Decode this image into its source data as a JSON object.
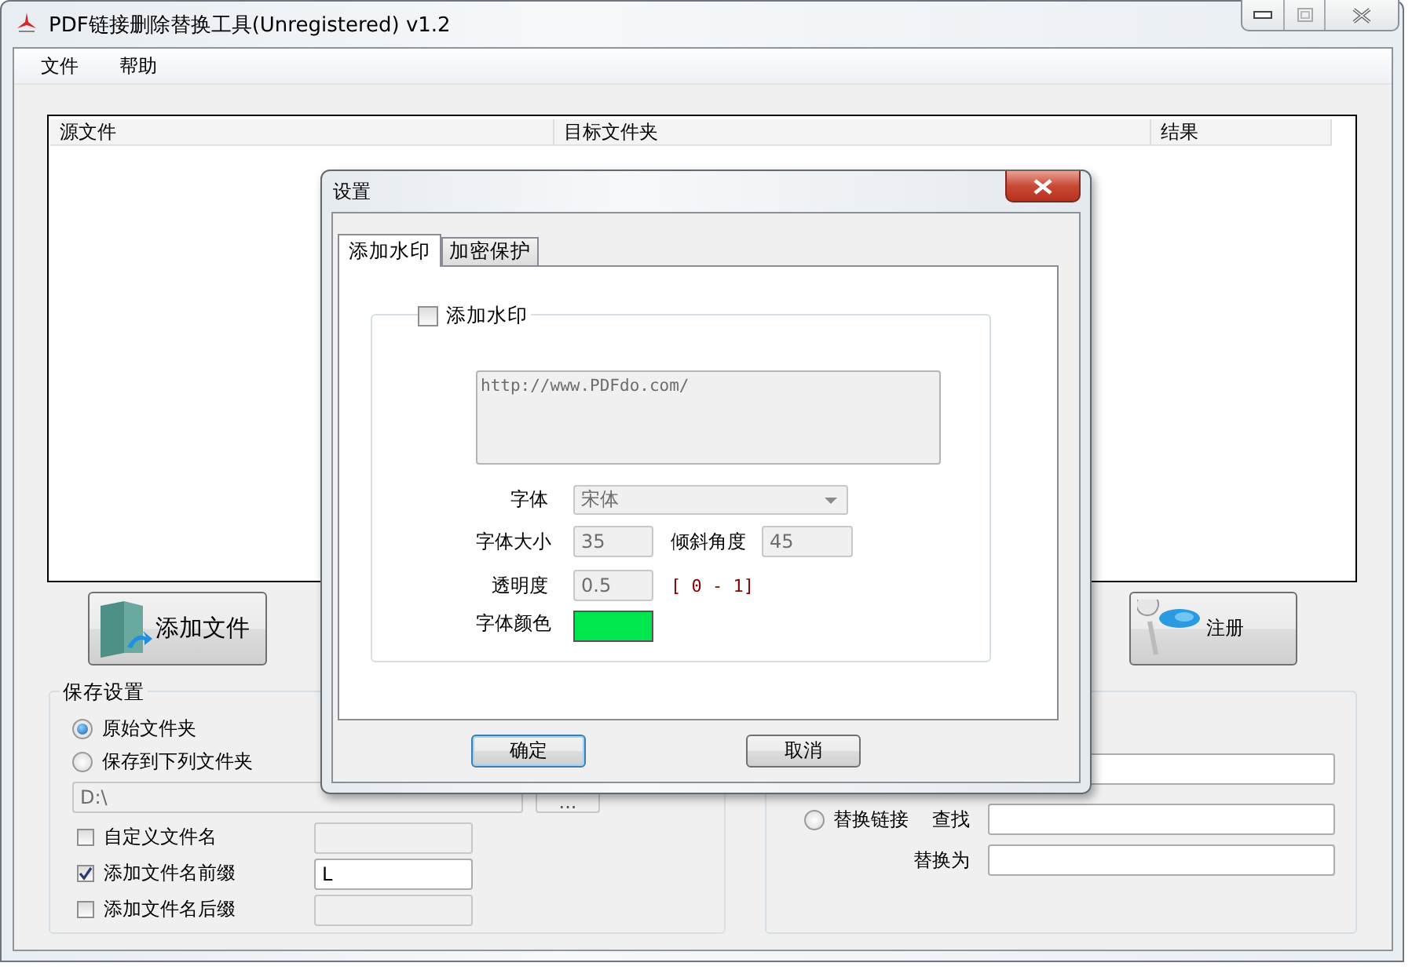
{
  "window": {
    "title": "PDF链接删除替换工具(Unregistered) v1.2"
  },
  "menu": [
    "文件",
    "帮助"
  ],
  "file_table": {
    "columns": [
      "源文件",
      "目标文件夹",
      "结果"
    ]
  },
  "buttons": [
    {
      "kind": "add",
      "label": "添加文件"
    },
    {
      "kind": "register",
      "label": "注册"
    }
  ],
  "save_settings": {
    "title": "保存设置",
    "options": [
      {
        "label": "原始文件夹",
        "selected": true
      },
      {
        "label": "保存到下列文件夹",
        "selected": false
      }
    ],
    "folder": "D:\\",
    "browse": "...",
    "name_options": [
      {
        "label": "自定义文件名",
        "checked": false
      },
      {
        "label": "添加文件名前缀",
        "checked": true,
        "value": "L"
      },
      {
        "label": "添加文件名后缀",
        "checked": false
      }
    ]
  },
  "link_settings": {
    "rows": [
      {
        "kind": "field"
      },
      {
        "kind": "radio",
        "option": "替换链接",
        "selected": false,
        "label": "查找"
      },
      {
        "kind": "labeled",
        "label": "替换为"
      }
    ]
  },
  "dialog": {
    "title": "设置",
    "tabs": [
      {
        "label": "添加水印",
        "selected": true
      },
      {
        "label": "加密保护",
        "selected": false
      }
    ],
    "watermark": {
      "label": "添加水印",
      "checked": false,
      "text": "http://www.PDFdo.com/",
      "font_label": "字体",
      "font": "宋体",
      "size_label": "字体大小",
      "size": "35",
      "angle_label": "倾斜角度",
      "angle": "45",
      "opacity_label": "透明度",
      "opacity": "0.5",
      "range": "[ 0 - 1]",
      "color_label": "字体颜色",
      "color": "#00e64d"
    },
    "buttons": [
      {
        "label": "确定",
        "focused": true
      },
      {
        "label": "取消",
        "focused": false
      }
    ]
  }
}
